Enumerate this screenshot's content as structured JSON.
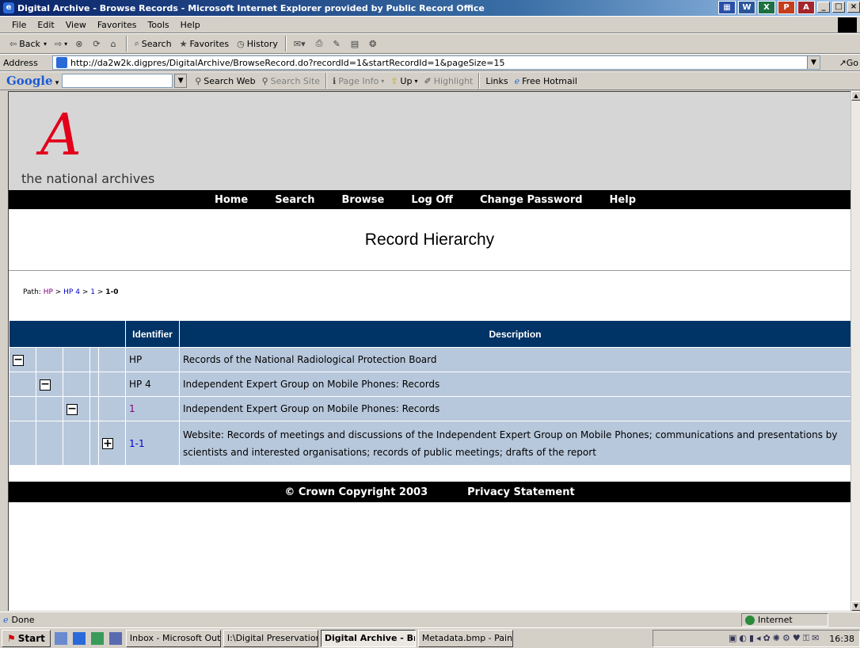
{
  "window": {
    "title": "Digital Archive - Browse Records - Microsoft Internet Explorer provided by Public Record Office",
    "buttons": [
      "_",
      "□",
      "×"
    ]
  },
  "menu": [
    "File",
    "Edit",
    "View",
    "Favorites",
    "Tools",
    "Help"
  ],
  "toolbar": {
    "back": "Back",
    "search": "Search",
    "favorites": "Favorites",
    "history": "History"
  },
  "address": {
    "label": "Address",
    "url": "http://da2w2k.digpres/DigitalArchive/BrowseRecord.do?recordId=1&startRecordId=1&pageSize=15",
    "go": "Go"
  },
  "google": {
    "logo": "Google",
    "search_web": "Search Web",
    "search_site": "Search Site",
    "page_info": "Page Info",
    "up": "Up",
    "highlight": "Highlight",
    "links": "Links",
    "free_hotmail": "Free Hotmail"
  },
  "site": {
    "logo_letter": "A",
    "logo_text": "the national archives",
    "nav": [
      "Home",
      "Search",
      "Browse",
      "Log Off",
      "Change Password",
      "Help"
    ],
    "page_title": "Record Hierarchy",
    "path": {
      "label": "Path:",
      "crumbs": [
        "HP",
        "HP 4",
        "1"
      ],
      "current": "1-0"
    },
    "table": {
      "headers": {
        "identifier": "Identifier",
        "description": "Description"
      },
      "rows": [
        {
          "id": "HP",
          "desc": "Records of the National Radiological Protection Board",
          "toggle": "−"
        },
        {
          "id": "HP 4",
          "desc": "Independent Expert Group on Mobile Phones: Records",
          "toggle": "−"
        },
        {
          "id": "1",
          "desc": "Independent Expert Group on Mobile Phones: Records",
          "toggle": "−"
        },
        {
          "id": "1-1",
          "desc": "Website: Records of meetings and discussions of the Independent Expert Group on Mobile Phones; communications and presentations by scientists and interested organisations; records of public meetings; drafts of the report",
          "toggle": "+"
        }
      ]
    },
    "footer": {
      "copyright": "© Crown Copyright 2003",
      "privacy": "Privacy Statement"
    }
  },
  "status": {
    "text": "Done",
    "zone": "Internet"
  },
  "taskbar": {
    "start": "Start",
    "tasks": [
      "Inbox - Microsoft Outl...",
      "I:\\Digital Preservation...",
      "Digital Archive - Br...",
      "Metadata.bmp - Paint"
    ],
    "clock": "16:38"
  }
}
